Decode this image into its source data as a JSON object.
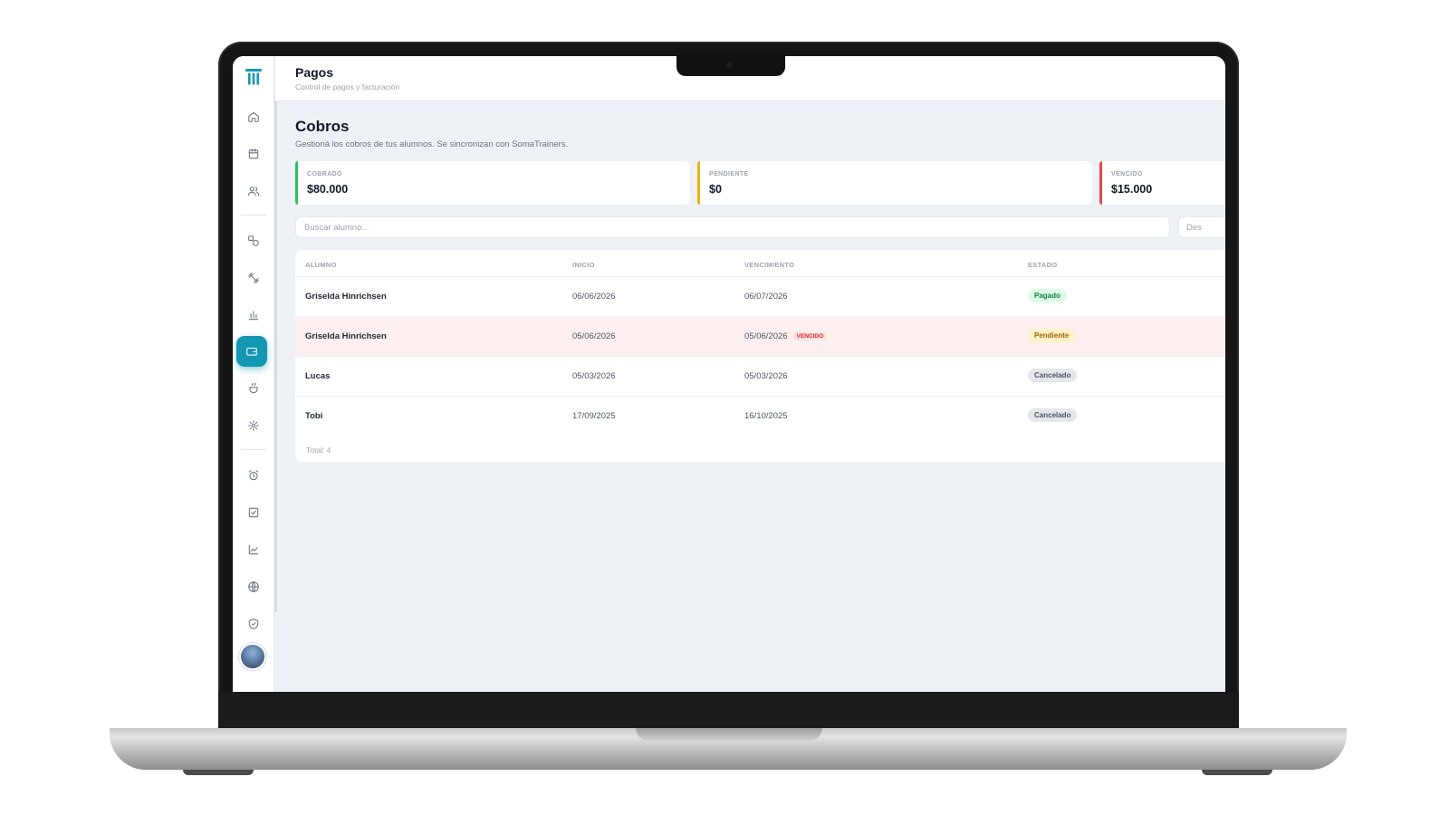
{
  "header": {
    "title": "Pagos",
    "subtitle": "Control de pagos y facturación"
  },
  "section": {
    "title": "Cobros",
    "description": "Gestioná los cobros de tus alumnos. Se sincronizan con SomaTrainers."
  },
  "stats": [
    {
      "label": "COBRADO",
      "value": "$80.000",
      "accent": "#22c55e"
    },
    {
      "label": "PENDIENTE",
      "value": "$0",
      "accent": "#eab308"
    },
    {
      "label": "VENCIDO",
      "value": "$15.000",
      "accent": "#ef4444"
    }
  ],
  "search": {
    "placeholder": "Buscar alumno..."
  },
  "date_filter": {
    "label": "Des"
  },
  "table": {
    "columns": [
      "ALUMNO",
      "INICIO",
      "VENCIMIENTO",
      "ESTADO"
    ],
    "rows": [
      {
        "alumno": "Griselda Hinrichsen",
        "inicio": "06/06/2026",
        "vencimiento": "06/07/2026",
        "vencido_tag": "",
        "estado": "Pagado"
      },
      {
        "alumno": "Griselda Hinrichsen",
        "inicio": "05/06/2026",
        "vencimiento": "05/06/2026",
        "vencido_tag": "VENCIDO",
        "estado": "Pendiente"
      },
      {
        "alumno": "Lucas",
        "inicio": "05/03/2026",
        "vencimiento": "05/03/2026",
        "vencido_tag": "",
        "estado": "Cancelado"
      },
      {
        "alumno": "Tobi",
        "inicio": "17/09/2025",
        "vencimiento": "16/10/2025",
        "vencido_tag": "",
        "estado": "Cancelado"
      }
    ],
    "total": "Total: 4"
  },
  "sidebar": {
    "icons": [
      "logo-icon",
      "home-icon",
      "calendar-icon",
      "users-icon",
      "exercises-icon",
      "workout-icon",
      "chart-bar-icon",
      "wallet-icon",
      "nutrition-icon",
      "settings-icon",
      "alarm-icon",
      "checklist-icon",
      "line-chart-icon",
      "globe-icon",
      "shield-icon"
    ],
    "active": "wallet-icon"
  },
  "colors": {
    "accent": "#1597b3",
    "paid": "#15803d",
    "pending": "#a16207",
    "overdue": "#dc2626"
  }
}
